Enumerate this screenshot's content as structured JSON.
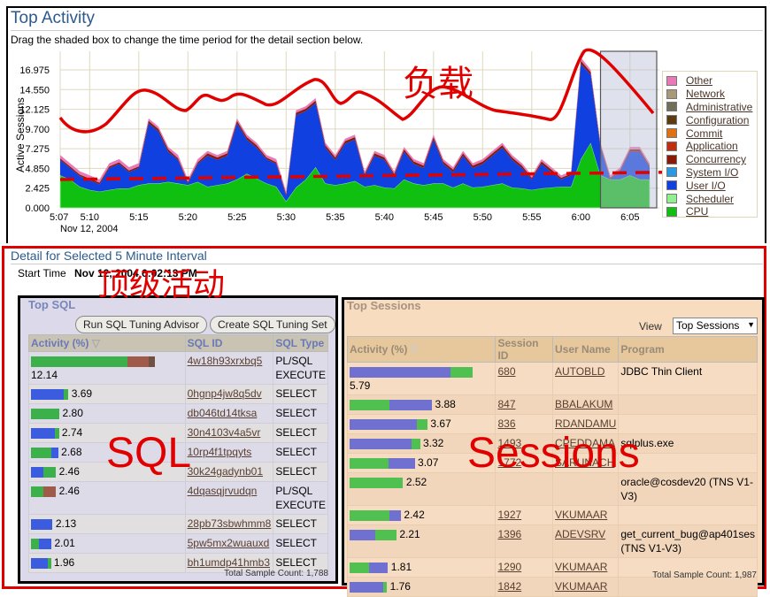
{
  "header": {
    "title": "Top Activity",
    "subtitle": "Drag the shaded box to change the time period for the detail section below."
  },
  "chart_data": {
    "type": "area",
    "stacked": true,
    "ylabel": "Active Sessions",
    "xlabel_date": "Nov 12, 2004",
    "yticks": [
      "0.000",
      "2.425",
      "4.850",
      "7.275",
      "9.700",
      "12.125",
      "14.550",
      "16.975"
    ],
    "ylim": [
      0,
      19.4
    ],
    "grid": true,
    "legend_placement": "right",
    "x_tick_labels": [
      {
        "label": "5:07",
        "minute": 0
      },
      {
        "label": "5:10",
        "minute": 3
      },
      {
        "label": "5:15",
        "minute": 8
      },
      {
        "label": "5:20",
        "minute": 13
      },
      {
        "label": "5:25",
        "minute": 18
      },
      {
        "label": "5:30",
        "minute": 23
      },
      {
        "label": "5:35",
        "minute": 28
      },
      {
        "label": "5:40",
        "minute": 33
      },
      {
        "label": "5:45",
        "minute": 38
      },
      {
        "label": "5:50",
        "minute": 43
      },
      {
        "label": "5:55",
        "minute": 48
      },
      {
        "label": "6:00",
        "minute": 53
      },
      {
        "label": "6:05",
        "minute": 58
      }
    ],
    "x_start": "5:07",
    "x_step_minutes": 1,
    "selection": {
      "start": "6:02",
      "end": "6:07"
    },
    "legend": [
      {
        "name": "Other",
        "color": "#e87ab8"
      },
      {
        "name": "Network",
        "color": "#a89a78"
      },
      {
        "name": "Administrative",
        "color": "#70705a"
      },
      {
        "name": "Configuration",
        "color": "#5a3c10"
      },
      {
        "name": "Commit",
        "color": "#e07010"
      },
      {
        "name": "Application",
        "color": "#c03010"
      },
      {
        "name": "Concurrency",
        "color": "#8a1a08"
      },
      {
        "name": "System I/O",
        "color": "#2a9ae0"
      },
      {
        "name": "User I/O",
        "color": "#1040e0"
      },
      {
        "name": "Scheduler",
        "color": "#90f090"
      },
      {
        "name": "CPU",
        "color": "#10c010"
      }
    ],
    "series": [
      {
        "name": "CPU",
        "color": "#10c010",
        "values": [
          4.0,
          3.5,
          2.6,
          2.2,
          2.0,
          2.2,
          2.4,
          2.4,
          2.8,
          3.0,
          3.0,
          3.2,
          3.0,
          2.8,
          3.2,
          2.6,
          2.8,
          3.0,
          3.5,
          4.2,
          3.6,
          3.0,
          2.6,
          0.8,
          2.5,
          3.5,
          5.0,
          3.0,
          2.8,
          3.0,
          3.3,
          2.6,
          2.8,
          2.5,
          2.4,
          3.5,
          3.0,
          2.8,
          3.0,
          3.0,
          2.5,
          3.0,
          2.5,
          2.6,
          2.8,
          3.0,
          2.5,
          2.4,
          2.2,
          2.4,
          2.5,
          2.6,
          2.6,
          6.0,
          8.0,
          4.0,
          3.5,
          3.5,
          4.0,
          3.5,
          3.5
        ]
      },
      {
        "name": "User I/O",
        "color": "#1040e0",
        "values": [
          1.9,
          1.4,
          1.3,
          1.2,
          0.9,
          2.7,
          3.0,
          2.0,
          2.1,
          7.4,
          6.4,
          3.7,
          2.9,
          0.2,
          2.2,
          3.8,
          3.1,
          3.4,
          6.9,
          4.2,
          3.8,
          3.0,
          2.8,
          0.7,
          8.9,
          8.4,
          7.9,
          4.4,
          3.1,
          4.9,
          5.1,
          1.4,
          3.6,
          3.4,
          1.6,
          3.4,
          2.4,
          2.1,
          5.4,
          2.4,
          1.9,
          3.4,
          2.4,
          2.8,
          3.6,
          4.4,
          3.4,
          2.5,
          1.3,
          3.0,
          1.9,
          0.9,
          1.4,
          11.7,
          8.4,
          3.4,
          0.0,
          1.0,
          2.9,
          3.4,
          1.5
        ]
      },
      {
        "name": "Concurrency",
        "color": "#8a1a08",
        "values": [
          0.2,
          0.2,
          0.2,
          0.2,
          0.2,
          0.2,
          0.2,
          0.2,
          0.2,
          0.3,
          0.3,
          0.3,
          0.2,
          0.2,
          0.2,
          0.3,
          0.3,
          0.3,
          0.3,
          0.3,
          0.3,
          0.2,
          0.2,
          0.2,
          0.3,
          0.3,
          0.3,
          0.3,
          0.3,
          0.3,
          0.3,
          0.2,
          0.3,
          0.3,
          0.2,
          0.3,
          0.3,
          0.3,
          0.3,
          0.3,
          0.3,
          0.3,
          0.3,
          0.3,
          0.3,
          0.3,
          0.3,
          0.3,
          0.2,
          0.3,
          0.3,
          0.2,
          0.2,
          0.4,
          0.3,
          0.3,
          0.2,
          0.2,
          0.3,
          0.3,
          0.2
        ]
      },
      {
        "name": "Other",
        "color": "#e87ab8",
        "values": [
          0.4,
          0.4,
          0.4,
          0.4,
          0.4,
          0.4,
          0.4,
          0.4,
          0.4,
          0.3,
          0.3,
          0.3,
          0.4,
          0.3,
          0.4,
          0.3,
          0.3,
          0.3,
          0.3,
          0.3,
          0.3,
          0.3,
          0.4,
          0.3,
          0.3,
          0.3,
          0.3,
          0.3,
          0.3,
          0.3,
          0.3,
          0.3,
          0.3,
          0.3,
          0.3,
          0.3,
          0.3,
          0.3,
          0.3,
          0.3,
          0.3,
          0.3,
          0.3,
          0.3,
          0.3,
          0.3,
          0.3,
          0.3,
          0.3,
          0.3,
          0.3,
          0.3,
          0.3,
          0.4,
          0.3,
          0.3,
          0.3,
          0.3,
          0.3,
          0.3,
          0.3
        ]
      }
    ]
  },
  "annotations": {
    "load": "负载",
    "top_activity": "顶级活动",
    "sql": "SQL",
    "sessions": "Sessions",
    "color": "#e00000"
  },
  "detail": {
    "title": "Detail for Selected 5 Minute Interval",
    "start_label": "Start Time",
    "start_value": "Nov 12, 2004 6:02:13 PM"
  },
  "top_sql": {
    "title": "Top SQL",
    "buttons": {
      "advisor": "Run SQL Tuning Advisor",
      "tuning_set": "Create SQL Tuning Set"
    },
    "columns": [
      "Activity (%)",
      "SQL ID",
      "SQL Type"
    ],
    "rows": [
      {
        "activity": "12.14",
        "sql_id": "4w18h93xrxbq5",
        "type": "PL/SQL EXECUTE",
        "segments": [
          [
            "#3cb04a",
            0.78
          ],
          [
            "#a05a4a",
            0.17
          ],
          [
            "#705040",
            0.05
          ]
        ]
      },
      {
        "activity": "3.69",
        "sql_id": "0hgnp4jw8q5dv",
        "type": "SELECT",
        "segments": [
          [
            "#3c5ce0",
            0.88
          ],
          [
            "#3cb04a",
            0.12
          ]
        ]
      },
      {
        "activity": "2.80",
        "sql_id": "db046td14tksa",
        "type": "SELECT",
        "segments": [
          [
            "#3cb04a",
            1
          ]
        ]
      },
      {
        "activity": "2.74",
        "sql_id": "30n4103v4a5vr",
        "type": "SELECT",
        "segments": [
          [
            "#3c5ce0",
            0.85
          ],
          [
            "#3cb04a",
            0.15
          ]
        ]
      },
      {
        "activity": "2.68",
        "sql_id": "10rp4f1tpqyts",
        "type": "SELECT",
        "segments": [
          [
            "#3cb04a",
            0.75
          ],
          [
            "#3c5ce0",
            0.25
          ]
        ]
      },
      {
        "activity": "2.46",
        "sql_id": "30k24gadynb01",
        "type": "SELECT",
        "segments": [
          [
            "#3c5ce0",
            0.5
          ],
          [
            "#3cb04a",
            0.5
          ]
        ]
      },
      {
        "activity": "2.46",
        "sql_id": "4dqasqjrvudqn",
        "type": "PL/SQL EXECUTE",
        "segments": [
          [
            "#3cb04a",
            0.5
          ],
          [
            "#a05a4a",
            0.5
          ]
        ]
      },
      {
        "activity": "2.13",
        "sql_id": "28pb73sbwhmm8",
        "type": "SELECT",
        "segments": [
          [
            "#3c5ce0",
            1
          ]
        ]
      },
      {
        "activity": "2.01",
        "sql_id": "5pw5mx2wuauxd",
        "type": "SELECT",
        "segments": [
          [
            "#3cb04a",
            0.4
          ],
          [
            "#3c5ce0",
            0.6
          ]
        ]
      },
      {
        "activity": "1.96",
        "sql_id": "bh1umdp41hmb3",
        "type": "SELECT",
        "segments": [
          [
            "#3c5ce0",
            0.85
          ],
          [
            "#3cb04a",
            0.15
          ]
        ]
      }
    ],
    "total": "Total Sample Count: 1,788"
  },
  "top_sessions": {
    "title": "Top Sessions",
    "view_label": "View",
    "view_value": "Top Sessions",
    "columns": [
      "Activity (%)",
      "Session ID",
      "User Name",
      "Program"
    ],
    "rows": [
      {
        "activity": "5.79",
        "sid": "680",
        "user": "AUTOBLD",
        "program": "JDBC Thin Client",
        "segments": [
          [
            "#7070d0",
            0.82
          ],
          [
            "#50c050",
            0.18
          ]
        ]
      },
      {
        "activity": "3.88",
        "sid": "847",
        "user": "BBALAKUM",
        "program": "",
        "segments": [
          [
            "#50c050",
            0.48
          ],
          [
            "#7070d0",
            0.52
          ]
        ]
      },
      {
        "activity": "3.67",
        "sid": "836",
        "user": "RDANDAMU",
        "program": "",
        "segments": [
          [
            "#7070d0",
            0.86
          ],
          [
            "#50c050",
            0.14
          ]
        ]
      },
      {
        "activity": "3.32",
        "sid": "1493",
        "user": "CPEDDAMA",
        "program": "sqlplus.exe",
        "segments": [
          [
            "#7070d0",
            0.88
          ],
          [
            "#50c050",
            0.12
          ]
        ]
      },
      {
        "activity": "3.07",
        "sid": "1772",
        "user": "SARUNACH",
        "program": "",
        "segments": [
          [
            "#50c050",
            0.6
          ],
          [
            "#7070d0",
            0.4
          ]
        ]
      },
      {
        "activity": "2.52",
        "sid": "",
        "user": "",
        "program": "oracle@cosdev20 (TNS V1-V3)",
        "segments": [
          [
            "#50c050",
            1
          ]
        ]
      },
      {
        "activity": "2.42",
        "sid": "1927",
        "user": "VKUMAAR",
        "program": "",
        "segments": [
          [
            "#50c050",
            0.78
          ],
          [
            "#7070d0",
            0.22
          ]
        ]
      },
      {
        "activity": "2.21",
        "sid": "1396",
        "user": "ADEVSRV",
        "program": "get_current_bug@ap401ses (TNS V1-V3)",
        "segments": [
          [
            "#7070d0",
            0.55
          ],
          [
            "#50c050",
            0.45
          ]
        ]
      },
      {
        "activity": "1.81",
        "sid": "1290",
        "user": "VKUMAAR",
        "program": "",
        "segments": [
          [
            "#50c050",
            0.5
          ],
          [
            "#7070d0",
            0.5
          ]
        ]
      },
      {
        "activity": "1.76",
        "sid": "1842",
        "user": "VKUMAAR",
        "program": "",
        "segments": [
          [
            "#7070d0",
            0.9
          ],
          [
            "#50c050",
            0.1
          ]
        ]
      }
    ],
    "total": "Total Sample Count: 1,987"
  }
}
